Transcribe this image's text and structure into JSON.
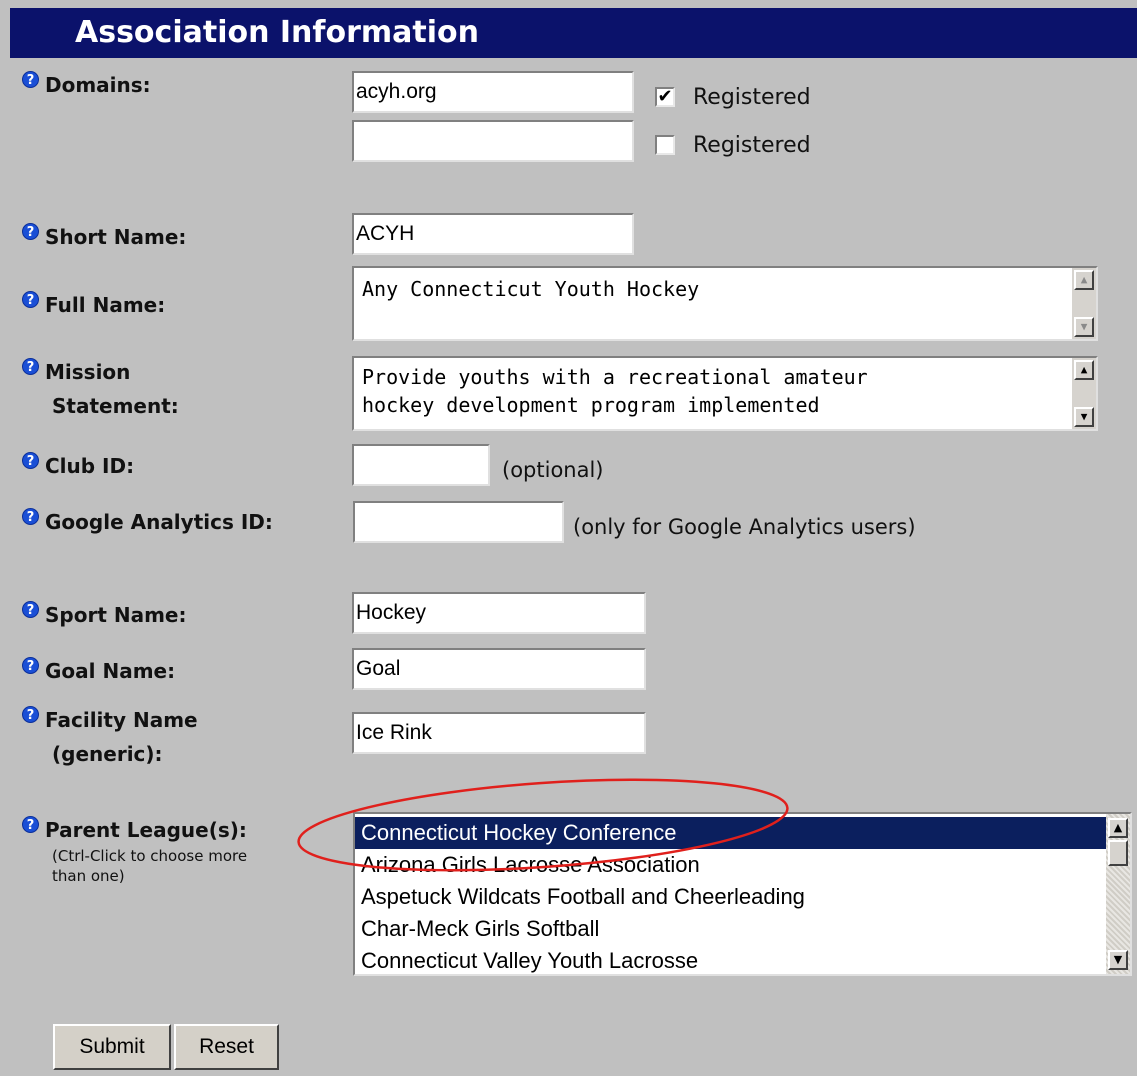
{
  "header": {
    "title": "Association Information"
  },
  "domains": {
    "label": "Domains:",
    "rows": [
      {
        "value": "acyh.org",
        "registered": true,
        "registered_label": "Registered"
      },
      {
        "value": "",
        "registered": false,
        "registered_label": "Registered"
      }
    ]
  },
  "short_name": {
    "label": "Short Name:",
    "value": "ACYH"
  },
  "full_name": {
    "label": "Full Name:",
    "value": "Any Connecticut Youth Hockey"
  },
  "mission": {
    "label_line1": "Mission",
    "label_line2": "Statement:",
    "line1": "Provide youths with a recreational amateur",
    "line2": "hockey development program implemented"
  },
  "club_id": {
    "label": "Club ID:",
    "value": "",
    "note": "(optional)"
  },
  "google_analytics": {
    "label": "Google Analytics ID:",
    "value": "",
    "note": "(only for Google Analytics users)"
  },
  "sport_name": {
    "label": "Sport Name:",
    "value": "Hockey"
  },
  "goal_name": {
    "label": "Goal Name:",
    "value": "Goal"
  },
  "facility_name": {
    "label_line1": "Facility Name",
    "label_line2": "(generic):",
    "value": "Ice Rink"
  },
  "parent_league": {
    "label": "Parent League(s):",
    "hint_line1": "(Ctrl-Click to choose more",
    "hint_line2": "than one)",
    "options": [
      "Connecticut Hockey Conference",
      "Arizona Girls Lacrosse Association",
      "Aspetuck Wildcats Football and Cheerleading",
      "Char-Meck Girls Softball",
      "Connecticut Valley Youth Lacrosse"
    ],
    "selected": "Connecticut Hockey Conference"
  },
  "buttons": {
    "submit": "Submit",
    "reset": "Reset"
  },
  "icons": {
    "help": "help-icon",
    "check": "check-icon",
    "scroll_up": "scroll-up-icon",
    "scroll_down": "scroll-down-icon"
  },
  "colors": {
    "header_bg": "#0b126b",
    "page_bg": "#c0c0c0",
    "selection": "#0b1f5e",
    "annotation": "#e0201c"
  }
}
